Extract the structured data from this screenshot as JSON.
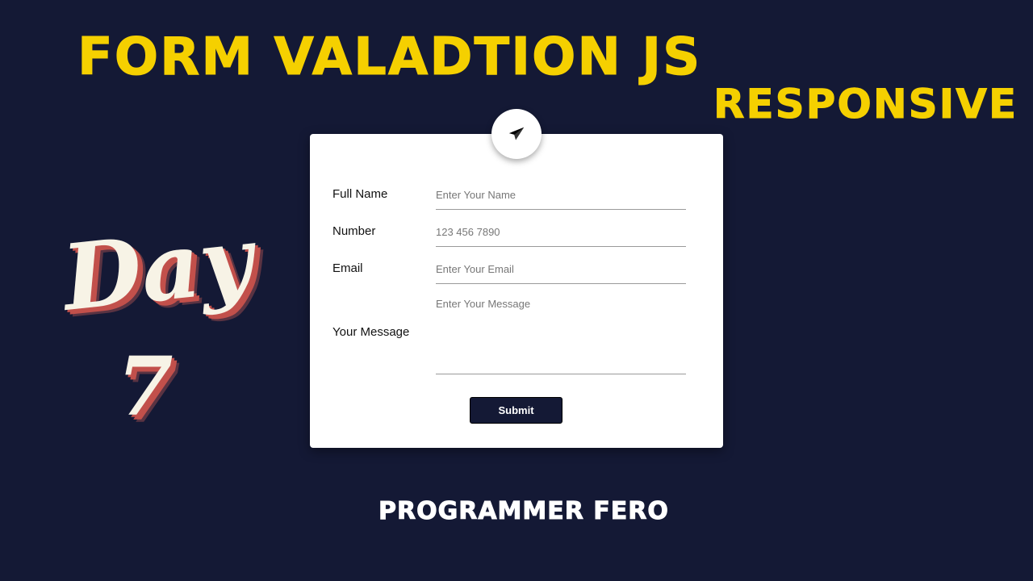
{
  "title": "FORM VALADTION JS",
  "subtitle": "RESPONSIVE",
  "day_word": "Day",
  "day_number": "7",
  "author": "PROGRAMMER FERO",
  "colors": {
    "background": "#141935",
    "accent": "#f5d000",
    "day_text": "#f7f3e6",
    "day_shadow": "#c2504b"
  },
  "form": {
    "icon": "paper-plane-icon",
    "fields": [
      {
        "label": "Full Name",
        "placeholder": "Enter Your Name"
      },
      {
        "label": "Number",
        "placeholder": "123 456 7890"
      },
      {
        "label": "Email",
        "placeholder": "Enter Your Email"
      },
      {
        "label": "Your Message",
        "placeholder": "Enter Your Message"
      }
    ],
    "submit_label": "Submit"
  }
}
